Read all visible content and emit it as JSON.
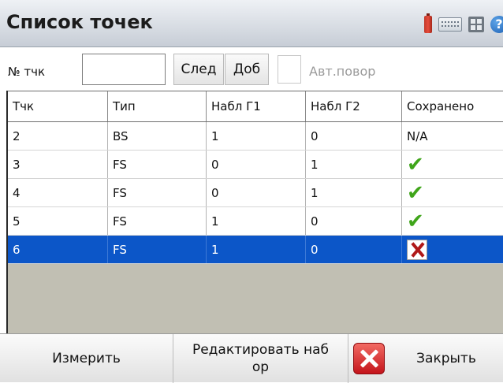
{
  "window": {
    "title": "Список точек"
  },
  "toolbar": {
    "point_label": "№ тчк",
    "point_value": "",
    "next_label": "След",
    "add_label": "Доб",
    "auto_rotate_label": "Авт.повор",
    "auto_rotate_checked": false
  },
  "table": {
    "headers": [
      "Тчк",
      "Тип",
      "Набл Г1",
      "Набл Г2",
      "Сохранено"
    ],
    "rows": [
      {
        "point": "2",
        "type": "BS",
        "obs1": "1",
        "obs2": "0",
        "saved": "N/A",
        "saved_icon": "none"
      },
      {
        "point": "3",
        "type": "FS",
        "obs1": "0",
        "obs2": "1",
        "saved": "",
        "saved_icon": "checkmark-icon"
      },
      {
        "point": "4",
        "type": "FS",
        "obs1": "0",
        "obs2": "1",
        "saved": "",
        "saved_icon": "checkmark-icon"
      },
      {
        "point": "5",
        "type": "FS",
        "obs1": "1",
        "obs2": "0",
        "saved": "",
        "saved_icon": "checkmark-icon"
      },
      {
        "point": "6",
        "type": "FS",
        "obs1": "1",
        "obs2": "0",
        "saved": "",
        "saved_icon": "cross-icon",
        "selected": true
      }
    ]
  },
  "bottom": {
    "measure_label": "Измерить",
    "edit_label_line1": "Редактировать наб",
    "edit_label_line2": "ор",
    "close_label": "Закрыть"
  },
  "colors": {
    "selection": "#0c56c8",
    "check": "#3fa51a",
    "cross": "#b01818"
  }
}
